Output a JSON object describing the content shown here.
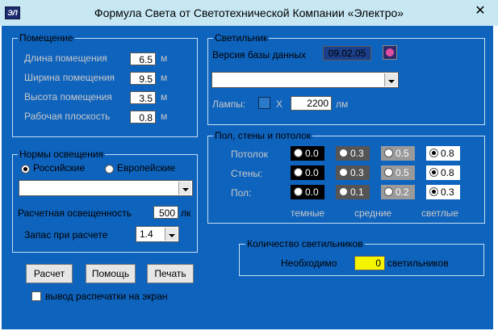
{
  "window": {
    "title": "Формула Света  от Светотехнической Компании «Электро»",
    "app_icon_text": "ЭЛ",
    "close_symbol": "✕"
  },
  "room": {
    "legend": "Помещение",
    "fields": [
      {
        "label": "Длина помещения",
        "value": "6.5",
        "unit": "м"
      },
      {
        "label": "Ширина помещения",
        "value": "9.5",
        "unit": "м"
      },
      {
        "label": "Высота помещения",
        "value": "3.5",
        "unit": "м"
      },
      {
        "label": "Рабочая плоскость",
        "value": "0.8",
        "unit": "м"
      }
    ]
  },
  "norms": {
    "legend": "Нормы освещения",
    "option_ru": "Российские",
    "option_eu": "Европейские",
    "selected": "ru",
    "category_value": "",
    "illuminance_label": "Расчетная освещенность",
    "illuminance_value": "500",
    "illuminance_unit": "лк",
    "reserve_label": "Запас при расчете",
    "reserve_value": "1.4"
  },
  "luminaire": {
    "legend": "Светильник",
    "db_version_label": "Версия базы данных",
    "db_version_value": "09.02.05",
    "model_value": "",
    "lamps_label": "Лампы:",
    "lamps_count": "",
    "multiply_sign": "X",
    "lumens_value": "2200",
    "lumens_unit": "лм"
  },
  "reflectance": {
    "legend": "Пол, стены и потолок",
    "rows": [
      {
        "label": "Потолок",
        "options": [
          "0.0",
          "0.3",
          "0.5",
          "0.8"
        ],
        "selected": 3
      },
      {
        "label": "Стены:",
        "options": [
          "0.0",
          "0.3",
          "0.5",
          "0.8"
        ],
        "selected": 3
      },
      {
        "label": "Пол:",
        "options": [
          "0.0",
          "0.1",
          "0.2",
          "0.3"
        ],
        "selected": 3
      }
    ],
    "column_labels": [
      "темные",
      "средние",
      "светлые"
    ],
    "colors": {
      "dark": "#000000",
      "mid": "#555555",
      "light": "#9a9a9a",
      "white": "#ffffff"
    }
  },
  "count": {
    "legend": "Количество светильников",
    "needed_label": "Необходимо",
    "value": "0",
    "unit_label": "светильников"
  },
  "buttons": {
    "calc": "Расчет",
    "help": "Помощь",
    "print": "Печать"
  },
  "print_preview": {
    "label": "вывод распечатки на экран",
    "checked": false
  },
  "colors": {
    "client_bg": "#0e63bd",
    "titlebar_bg": "#c7e8f3",
    "count_box": "#f5f500"
  }
}
